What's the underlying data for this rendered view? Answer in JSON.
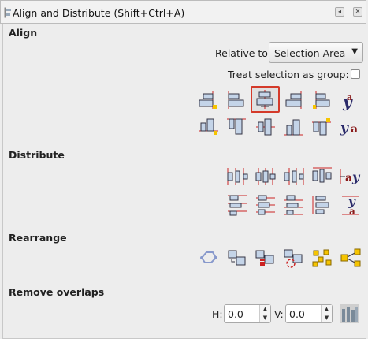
{
  "window": {
    "title": "Align and Distribute (Shift+Ctrl+A)",
    "button_left_glyph": "◂",
    "button_close_glyph": "✕"
  },
  "align": {
    "heading": "Align",
    "relative_to_label": "Relative to:",
    "relative_to_value": "Selection Area",
    "group_label": "Treat selection as group:",
    "group_checked": false,
    "selected_button": "center-on-vertical-axis",
    "text_glyph": "a",
    "baseline_glyph": "y"
  },
  "distribute": {
    "heading": "Distribute",
    "text_glyph": "a",
    "baseline_glyph": "y"
  },
  "rearrange": {
    "heading": "Rearrange"
  },
  "remove_overlaps": {
    "heading": "Remove overlaps",
    "h_label": "H:",
    "h_value": "0.0",
    "v_label": "V:",
    "v_value": "0.0"
  },
  "colors": {
    "accent_red": "#d43a2a",
    "object_fill": "#c4d4e8",
    "guide_red": "#cc2222",
    "yellow": "#f5c400"
  }
}
